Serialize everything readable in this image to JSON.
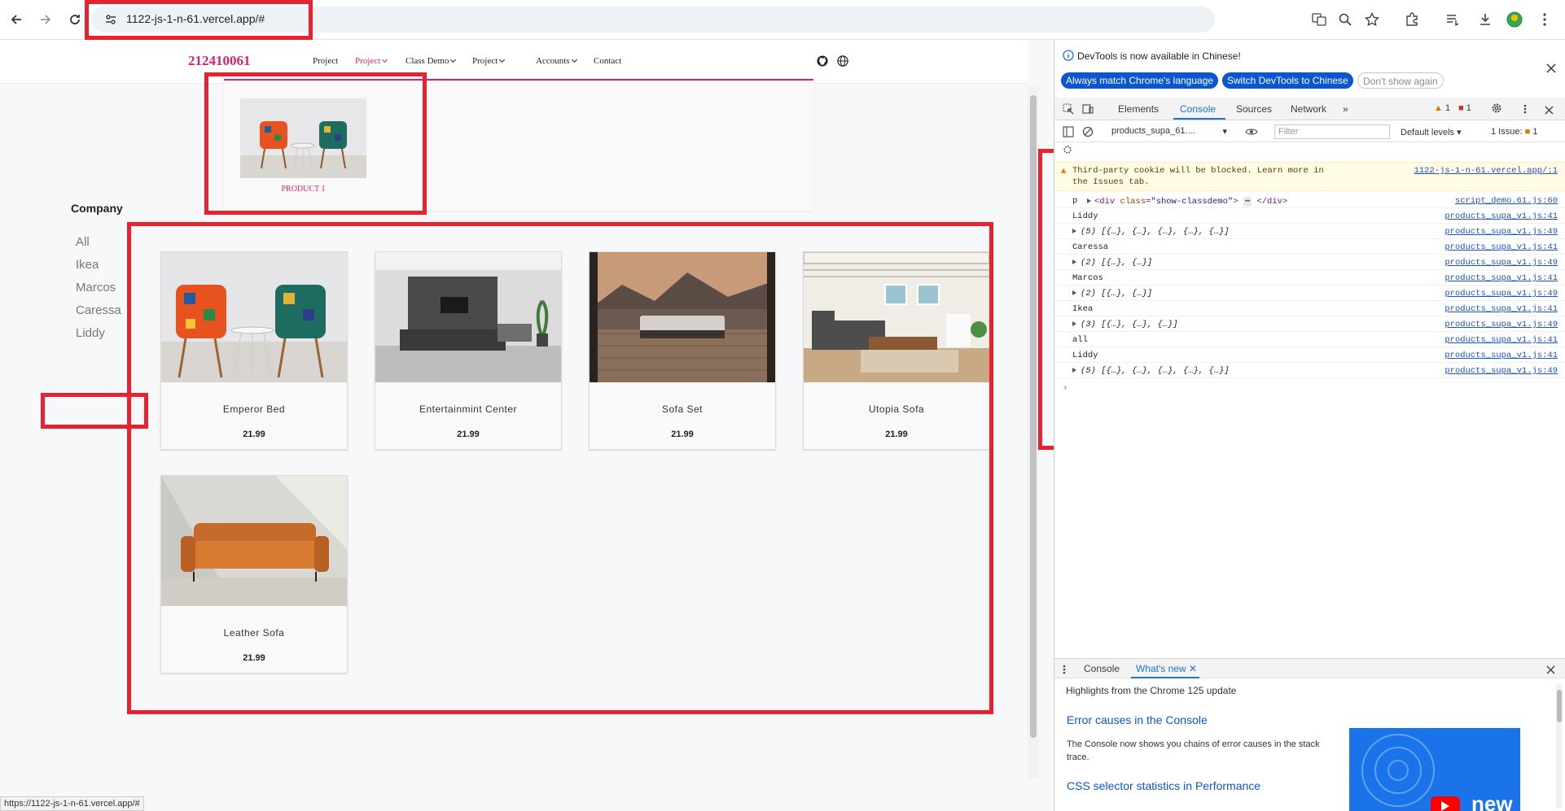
{
  "browser": {
    "url": "1122-js-1-n-61.vercel.app/#",
    "status_url": "https://1122-js-1-n-61.vercel.app/#"
  },
  "site": {
    "brand": "212410061",
    "nav": [
      {
        "label": "Project",
        "dropdown": false,
        "active": false
      },
      {
        "label": "Project",
        "dropdown": true,
        "active": true
      },
      {
        "label": "Class Demo",
        "dropdown": true,
        "active": false
      },
      {
        "label": "Project",
        "dropdown": true,
        "active": false
      },
      {
        "label": "Accounts",
        "dropdown": true,
        "active": false
      },
      {
        "label": "Contact",
        "dropdown": false,
        "active": false
      }
    ],
    "dropdown_item": "PRODUCT 1",
    "sidebar": {
      "title": "Company",
      "filters": [
        "All",
        "Ikea",
        "Marcos",
        "Caressa",
        "Liddy"
      ],
      "selected": "Liddy"
    },
    "products": [
      {
        "name": "Emperor Bed",
        "price": "21.99"
      },
      {
        "name": "Entertainmint Center",
        "price": "21.99"
      },
      {
        "name": "Sofa Set",
        "price": "21.99"
      },
      {
        "name": "Utopia Sofa",
        "price": "21.99"
      },
      {
        "name": "Leather Sofa",
        "price": "21.99"
      }
    ]
  },
  "devtools": {
    "info": "DevTools is now available in Chinese!",
    "btn_match": "Always match Chrome's language",
    "btn_switch": "Switch DevTools to Chinese",
    "btn_dismiss": "Don't show again",
    "tabs": [
      "Elements",
      "Console",
      "Sources",
      "Network"
    ],
    "active_tab": "Console",
    "warn_count": "1",
    "error_count": "1",
    "context": "products_supa_61....",
    "filter_placeholder": "Filter",
    "levels": "Default levels",
    "issues_label": "1 Issue:",
    "issues_count": "1",
    "warning": {
      "line1": "Third-party cookie will be blocked. Learn more in",
      "line2": "the Issues tab.",
      "source": "1122-js-1-n-61.vercel.app/:1"
    },
    "log_p_prefix": "p",
    "log_p_src": "script_demo.61.js:60",
    "logs": [
      {
        "msg": "Liddy",
        "src": "products_supa_v1.js:41",
        "expand": false
      },
      {
        "msg": "(5) [{…}, {…}, {…}, {…}, {…}]",
        "src": "products_supa_v1.js:49",
        "expand": true
      },
      {
        "msg": "Caressa",
        "src": "products_supa_v1.js:41",
        "expand": false
      },
      {
        "msg": "(2) [{…}, {…}]",
        "src": "products_supa_v1.js:49",
        "expand": true
      },
      {
        "msg": "Marcos",
        "src": "products_supa_v1.js:41",
        "expand": false
      },
      {
        "msg": "(2) [{…}, {…}]",
        "src": "products_supa_v1.js:49",
        "expand": true
      },
      {
        "msg": "Ikea",
        "src": "products_supa_v1.js:41",
        "expand": false
      },
      {
        "msg": "(3) [{…}, {…}, {…}]",
        "src": "products_supa_v1.js:49",
        "expand": true
      },
      {
        "msg": "all",
        "src": "products_supa_v1.js:41",
        "expand": false
      },
      {
        "msg": "Liddy",
        "src": "products_supa_v1.js:41",
        "expand": false
      },
      {
        "msg": "(5) [{…}, {…}, {…}, {…}, {…}]",
        "src": "products_supa_v1.js:49",
        "expand": true
      }
    ],
    "drawer": {
      "tab_console": "Console",
      "tab_whatsnew": "What's new",
      "highlight": "Highlights from the Chrome 125 update",
      "item1_title": "Error causes in the Console",
      "item1_body": "The Console now shows you chains of error causes in the stack trace.",
      "item2_title": "CSS selector statistics in Performance",
      "thumb_text": "new"
    }
  }
}
